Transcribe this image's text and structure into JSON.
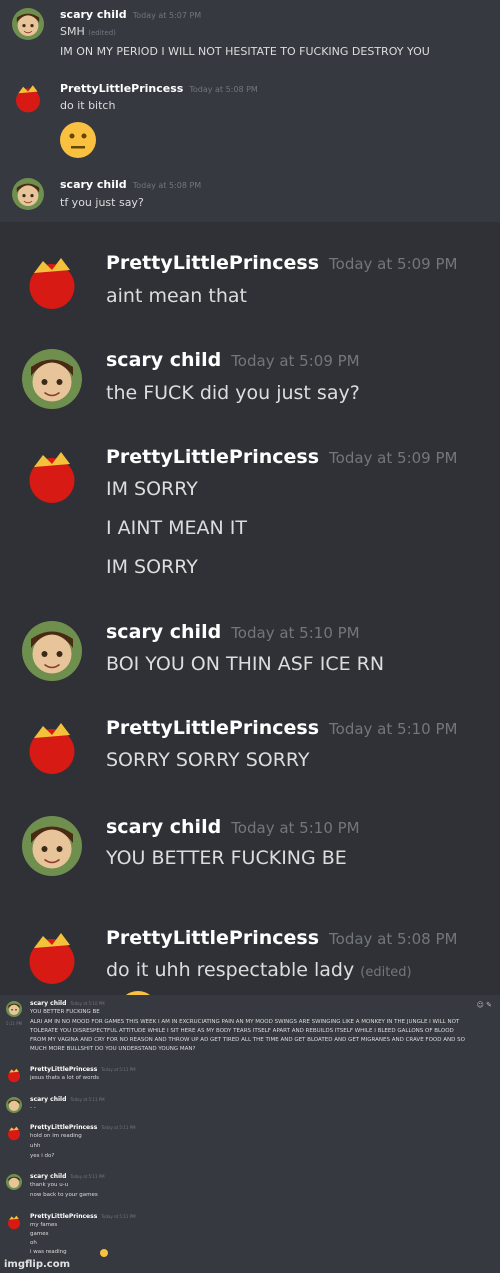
{
  "panel_a": {
    "messages": [
      {
        "author": "scary child",
        "time": "Today at 5:07 PM",
        "lines": [
          "SMH",
          "IM ON MY PERIOD I WILL NOT HESITATE TO FUCKING DESTROY YOU"
        ],
        "edited": "(edited)"
      },
      {
        "author": "PrettyLittlePrincess",
        "time": "Today at 5:08 PM",
        "lines": [
          "do it bitch"
        ]
      },
      {
        "author": "scary child",
        "time": "Today at 5:08 PM",
        "lines": [
          "tf you just say?"
        ]
      }
    ]
  },
  "panel_b": {
    "messages": [
      {
        "author": "PrettyLittlePrincess",
        "time": "Today at 5:09 PM",
        "lines": [
          "aint mean that"
        ]
      },
      {
        "author": "scary child",
        "time": "Today at 5:09 PM",
        "lines": [
          "the FUCK did you just say?"
        ]
      },
      {
        "author": "PrettyLittlePrincess",
        "time": "Today at 5:09 PM",
        "lines": [
          "IM SORRY",
          "I AINT MEAN IT",
          "IM SORRY"
        ]
      },
      {
        "author": "scary child",
        "time": "Today at 5:10 PM",
        "lines": [
          "BOI YOU ON THIN ASF ICE RN"
        ]
      },
      {
        "author": "PrettyLittlePrincess",
        "time": "Today at 5:10 PM",
        "lines": [
          "SORRY SORRY SORRY"
        ]
      },
      {
        "author": "scary child",
        "time": "Today at 5:10 PM",
        "lines": [
          "YOU BETTER FUCKING BE"
        ]
      },
      {
        "author": "PrettyLittlePrincess",
        "time": "Today at 5:08 PM",
        "lines": [
          "do it uhh respectable lady"
        ],
        "edited": "(edited)"
      }
    ]
  },
  "panel_c": {
    "messages": [
      {
        "author": "scary child",
        "time": "Today at 5:10 PM",
        "lines": [
          "YOU BETTER FUCKING BE"
        ],
        "side_time": "5:11 PM",
        "long": "ALRI AM IN NO MOOD FOR GAMES THIS WEEK I AM IN EXCRUCIATING PAIN AN MY MOOD SWINGS ARE SWINGING LIKE A MONKEY IN THE JUNGLE I WILL NOT TOLERATE YOU DISRESPECTFUL ATTITUDE WHILE I SIT HERE AS MY BODY TEARS ITSELF APART AND REBUILDS ITSELF WHILE I BLEED GALLONS OF BLOOD FROM MY VAGINA AND CRY FOR NO REASON AND THROW UP AD GET TIRED ALL THE TIME AND GET BLOATED AND GET MIGRANES AND CRAVE FOOD AND SO MUCH MORE BULLSHIT DO YOU UNDERSTAND YOUNG MAN?"
      },
      {
        "author": "PrettyLittlePrincess",
        "time": "Today at 5:11 PM",
        "lines": [
          "jesus thats a lot of words"
        ]
      },
      {
        "author": "scary child",
        "time": "Today at 5:11 PM",
        "lines": [
          "- -"
        ]
      },
      {
        "author": "PrettyLittlePrincess",
        "time": "Today at 5:11 PM",
        "lines": [
          "hold on im reading",
          "uhh",
          "yes i do?"
        ]
      },
      {
        "author": "scary child",
        "time": "Today at 5:11 PM",
        "lines": [
          "thank you u-u",
          "now back to your games"
        ]
      },
      {
        "author": "PrettyLittlePrincess",
        "time": "Today at 5:11 PM",
        "lines": [
          "my fames",
          "games",
          "oh",
          "i was reading"
        ]
      }
    ],
    "tools": "☺ ✎"
  },
  "watermark": "imgflip.com",
  "colors": {
    "background": "#36393f",
    "name": "#ffffff",
    "timestamp": "#72767d",
    "text": "#dcddde"
  }
}
